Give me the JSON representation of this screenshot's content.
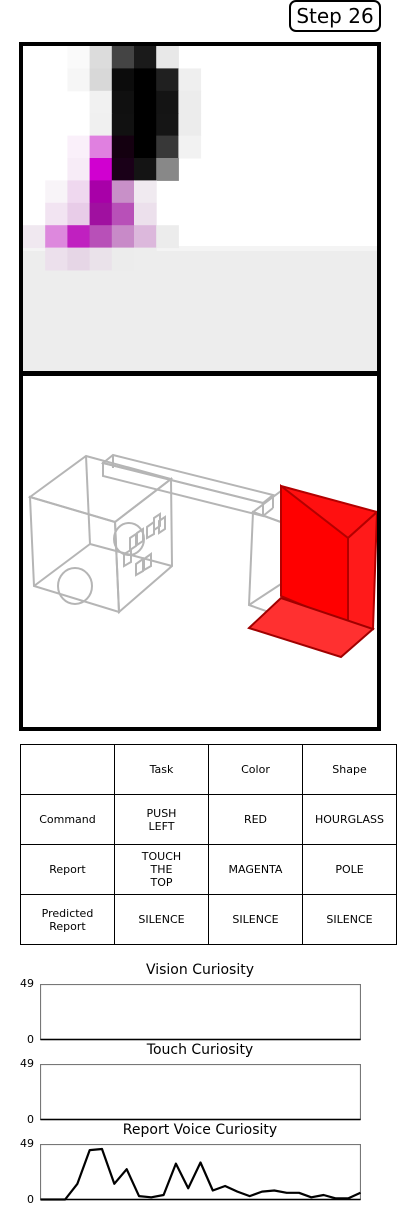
{
  "step": {
    "label": "Step 26"
  },
  "table": {
    "headers": [
      "",
      "Task",
      "Color",
      "Shape"
    ],
    "rows": [
      {
        "label": "Command",
        "task": "PUSH\nLEFT",
        "color": "RED",
        "shape": "HOURGLASS"
      },
      {
        "label": "Report",
        "task": "TOUCH\nTHE\nTOP",
        "color": "MAGENTA",
        "shape": "POLE"
      },
      {
        "label": "Predicted\nReport",
        "task": "SILENCE",
        "color": "SILENCE",
        "shape": "SILENCE"
      }
    ]
  },
  "colors": {
    "object": "#ff0000",
    "magenta": "#cc00cc"
  },
  "chart_data": [
    {
      "type": "line",
      "title": "Vision Curiosity",
      "ylim": [
        0,
        49
      ],
      "yticks": [
        0,
        49
      ],
      "values": []
    },
    {
      "type": "line",
      "title": "Touch Curiosity",
      "ylim": [
        0,
        49
      ],
      "yticks": [
        0,
        49
      ],
      "values": []
    },
    {
      "type": "line",
      "title": "Report Voice Curiosity",
      "ylim": [
        0,
        49
      ],
      "yticks": [
        0,
        49
      ],
      "values": [
        0,
        0,
        0,
        14,
        44,
        45,
        14,
        27,
        3,
        2,
        4,
        32,
        10,
        33,
        8,
        12,
        7,
        3,
        7,
        8,
        6,
        6,
        2,
        4,
        1,
        1,
        6
      ]
    }
  ]
}
